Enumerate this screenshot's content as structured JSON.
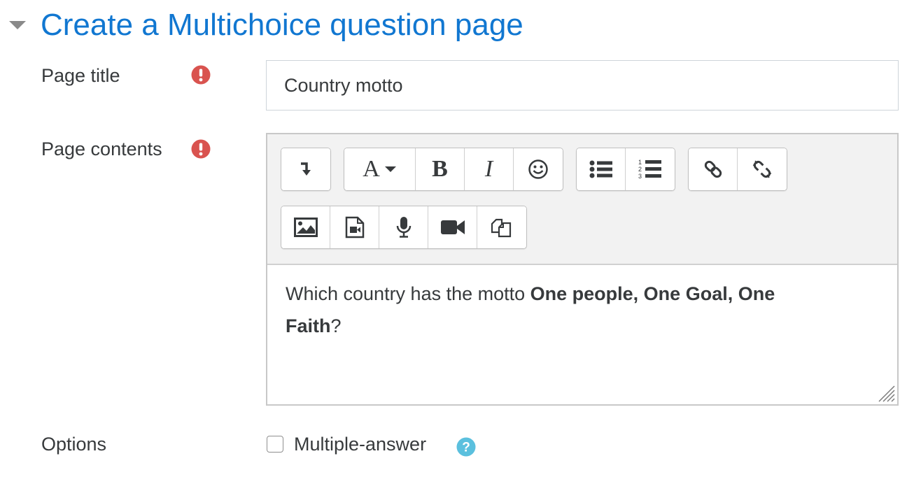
{
  "section": {
    "title": "Create a Multichoice question page",
    "title_color": "#1177d1"
  },
  "fields": {
    "page_title": {
      "label": "Page title",
      "value": "Country motto"
    },
    "page_contents": {
      "label": "Page contents",
      "content_prefix": "Which country has the motto ",
      "content_bold_1": "One people, One Goal, One",
      "content_bold_2": "Faith",
      "content_suffix": "?"
    },
    "options": {
      "label": "Options",
      "checkbox_label": "Multiple-answer",
      "checked": false
    }
  },
  "editor_toolbar": {
    "row1": [
      [
        "show-more-icon"
      ],
      [
        "font-style-icon",
        "bold-icon",
        "italic-icon",
        "emoji-icon"
      ],
      [
        "bullet-list-icon",
        "numbered-list-icon"
      ],
      [
        "link-icon",
        "unlink-icon"
      ]
    ],
    "row2": [
      [
        "image-icon",
        "media-icon",
        "record-audio-icon",
        "record-video-icon",
        "manage-files-icon"
      ]
    ],
    "font_style_glyph": "A",
    "bold_glyph": "B",
    "italic_glyph": "I"
  },
  "colors": {
    "required": "#d9534f",
    "help": "#5bc0de",
    "text": "#373a3c"
  }
}
